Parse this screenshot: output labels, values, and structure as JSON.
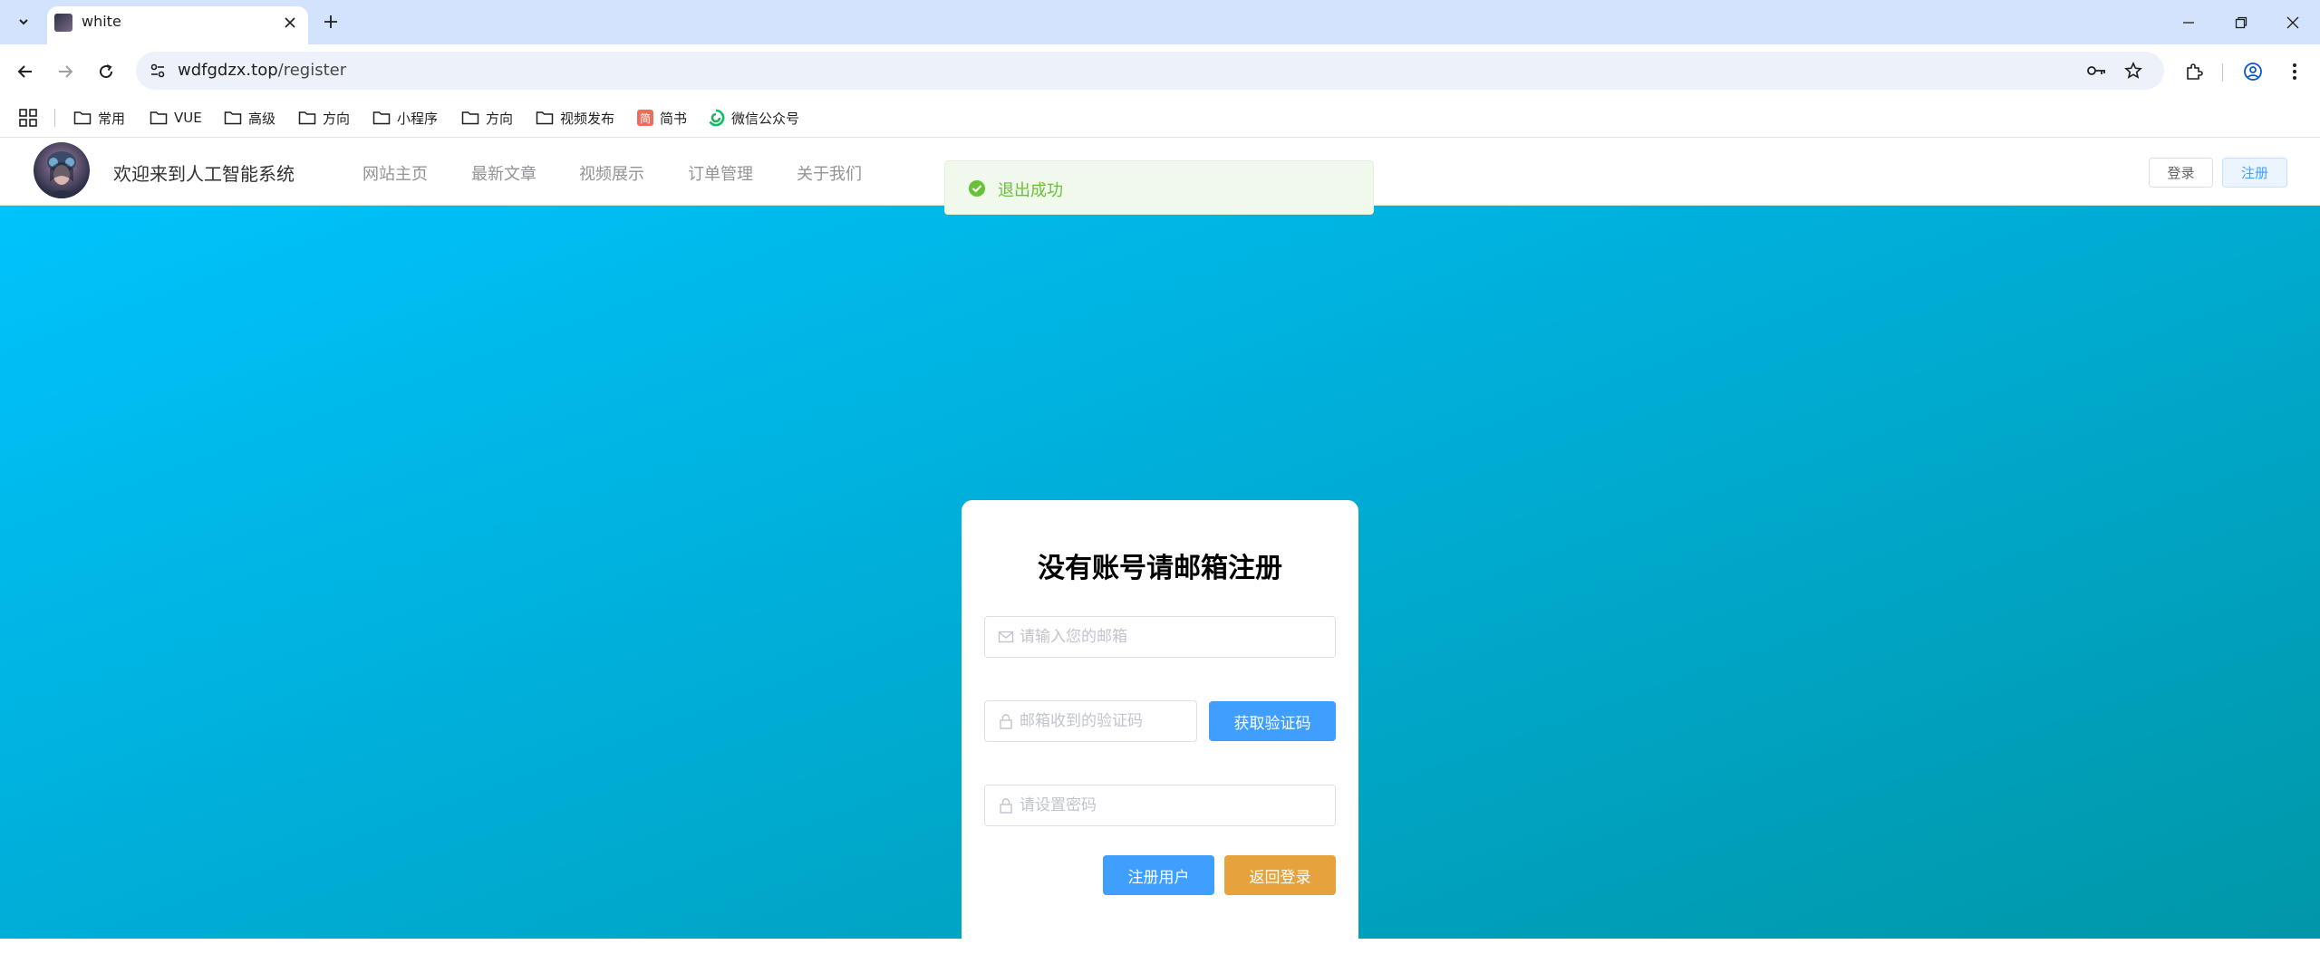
{
  "browser": {
    "tab": {
      "title": "white"
    },
    "address": {
      "host": "wdfgdzx.top",
      "path": "/register"
    },
    "bookmarks": [
      {
        "label": "常用",
        "icon": "folder-icon"
      },
      {
        "label": "VUE",
        "icon": "folder-icon"
      },
      {
        "label": "高级",
        "icon": "folder-icon"
      },
      {
        "label": "方向",
        "icon": "folder-icon"
      },
      {
        "label": "小程序",
        "icon": "folder-icon"
      },
      {
        "label": "方向",
        "icon": "folder-icon"
      },
      {
        "label": "视频发布",
        "icon": "folder-icon"
      },
      {
        "label": "简书",
        "icon": "jianshu-icon"
      },
      {
        "label": "微信公众号",
        "icon": "wechat-icon"
      }
    ]
  },
  "site": {
    "title": "欢迎来到人工智能系统",
    "nav": [
      "网站主页",
      "最新文章",
      "视频展示",
      "订单管理",
      "关于我们"
    ],
    "login_label": "登录",
    "register_label": "注册"
  },
  "toast": {
    "message": "退出成功",
    "color": "#67c23a"
  },
  "register_form": {
    "title": "没有账号请邮箱注册",
    "email_placeholder": "请输入您的邮箱",
    "email_value": "",
    "code_placeholder": "邮箱收到的验证码",
    "code_value": "",
    "get_code_label": "获取验证码",
    "password_placeholder": "请设置密码",
    "password_value": "",
    "submit_label": "注册用户",
    "back_label": "返回登录"
  },
  "colors": {
    "primary": "#409eff",
    "warning": "#e6a23c",
    "hero_start": "#00c3fc",
    "hero_end": "#0097a8"
  }
}
